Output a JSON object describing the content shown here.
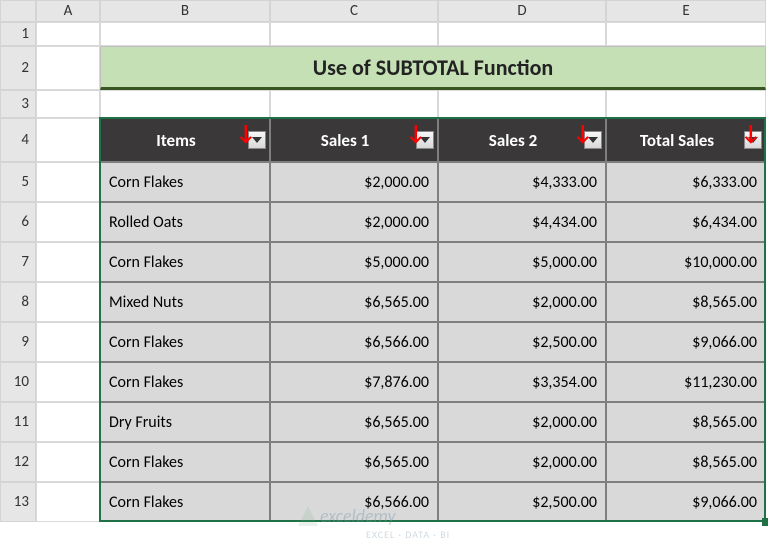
{
  "columns": [
    "A",
    "B",
    "C",
    "D",
    "E"
  ],
  "rows": [
    "1",
    "2",
    "3",
    "4",
    "5",
    "6",
    "7",
    "8",
    "9",
    "10",
    "11",
    "12",
    "13"
  ],
  "title": "Use of SUBTOTAL Function",
  "headers": {
    "items": "Items",
    "sales1": "Sales 1",
    "sales2": "Sales 2",
    "total": "Total Sales"
  },
  "chart_data": {
    "type": "table",
    "columns": [
      "Items",
      "Sales 1",
      "Sales 2",
      "Total Sales"
    ],
    "rows": [
      {
        "items": "Corn Flakes",
        "sales1": "$2,000.00",
        "sales2": "$4,333.00",
        "total": "$6,333.00"
      },
      {
        "items": "Rolled Oats",
        "sales1": "$2,000.00",
        "sales2": "$4,434.00",
        "total": "$6,434.00"
      },
      {
        "items": "Corn Flakes",
        "sales1": "$5,000.00",
        "sales2": "$5,000.00",
        "total": "$10,000.00"
      },
      {
        "items": "Mixed Nuts",
        "sales1": "$6,565.00",
        "sales2": "$2,000.00",
        "total": "$8,565.00"
      },
      {
        "items": "Corn Flakes",
        "sales1": "$6,566.00",
        "sales2": "$2,500.00",
        "total": "$9,066.00"
      },
      {
        "items": "Corn Flakes",
        "sales1": "$7,876.00",
        "sales2": "$3,354.00",
        "total": "$11,230.00"
      },
      {
        "items": "Dry Fruits",
        "sales1": "$6,565.00",
        "sales2": "$2,000.00",
        "total": "$8,565.00"
      },
      {
        "items": "Corn Flakes",
        "sales1": "$6,565.00",
        "sales2": "$2,000.00",
        "total": "$8,565.00"
      },
      {
        "items": "Corn Flakes",
        "sales1": "$6,566.00",
        "sales2": "$2,500.00",
        "total": "$9,066.00"
      }
    ]
  },
  "watermark": "exceldemy",
  "watermark_sub": "EXCEL · DATA · BI"
}
